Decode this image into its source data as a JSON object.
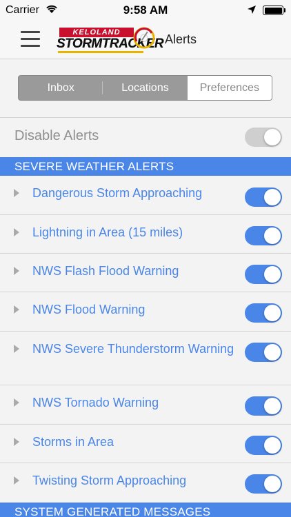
{
  "status_bar": {
    "carrier": "Carrier",
    "time": "9:58 AM"
  },
  "nav": {
    "logo_top": "KELOLAND",
    "logo_main": "STORMTRACKER",
    "title": "Alerts"
  },
  "tabs": [
    {
      "label": "Inbox",
      "selected": false
    },
    {
      "label": "Locations",
      "selected": false
    },
    {
      "label": "Preferences",
      "selected": true
    }
  ],
  "disable_alerts": {
    "label": "Disable Alerts",
    "enabled": false
  },
  "sections": [
    {
      "title": "SEVERE WEATHER ALERTS",
      "items": [
        {
          "label": "Dangerous Storm Approaching",
          "enabled": true
        },
        {
          "label": "Lightning in Area (15 miles)",
          "enabled": true
        },
        {
          "label": "NWS Flash Flood Warning",
          "enabled": true
        },
        {
          "label": "NWS Flood Warning",
          "enabled": true
        },
        {
          "label": "NWS Severe Thunderstorm Warning",
          "enabled": true
        },
        {
          "label": "NWS Tornado Warning",
          "enabled": true
        },
        {
          "label": "Storms in Area",
          "enabled": true
        },
        {
          "label": "Twisting Storm Approaching",
          "enabled": true
        }
      ]
    },
    {
      "title": "SYSTEM GENERATED MESSAGES",
      "items": []
    }
  ],
  "colors": {
    "accent": "#4a86e8",
    "toggle_off": "#cfcfcf",
    "segment_bg": "#9a9a9a",
    "brand_red": "#c8102e"
  }
}
